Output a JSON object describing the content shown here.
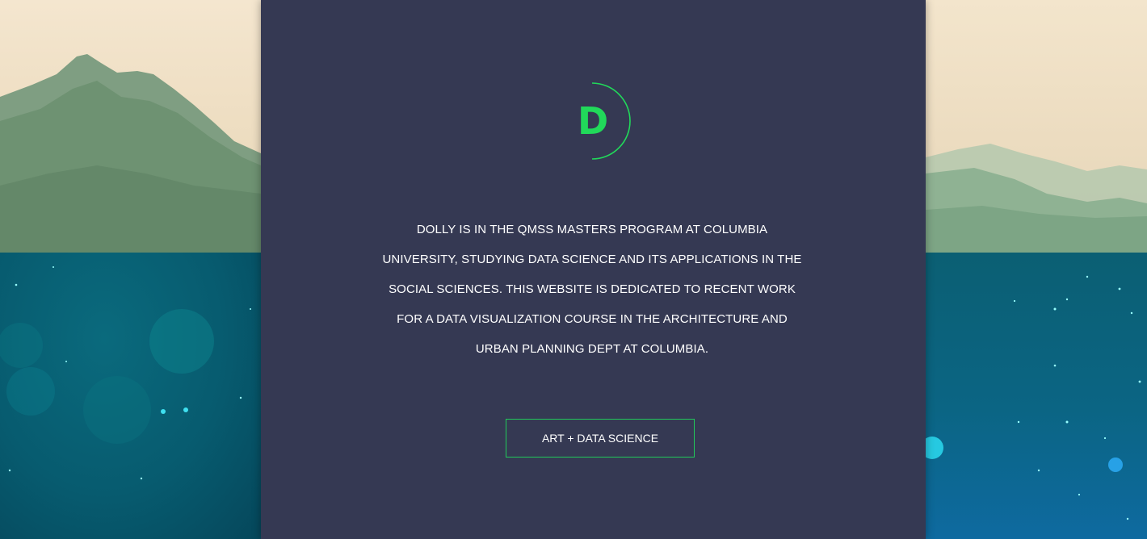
{
  "logo": {
    "letter": "D",
    "icon": "d-monogram-icon",
    "color": "#21d95a"
  },
  "bio": {
    "text": "DOLLY IS IN THE QMSS MASTERS PROGRAM AT COLUMBIA UNIVERSITY, STUDYING DATA SCIENCE AND ITS APPLICATIONS IN THE SOCIAL SCIENCES. THIS WEBSITE IS DEDICATED TO RECENT WORK FOR A DATA VISUALIZATION COURSE IN THE ARCHITECTURE AND URBAN PLANNING DEPT AT COLUMBIA."
  },
  "cta": {
    "label": "ART + DATA SCIENCE"
  },
  "colors": {
    "panel": "#353953",
    "accent": "#21d95a",
    "text": "#ffffff"
  }
}
